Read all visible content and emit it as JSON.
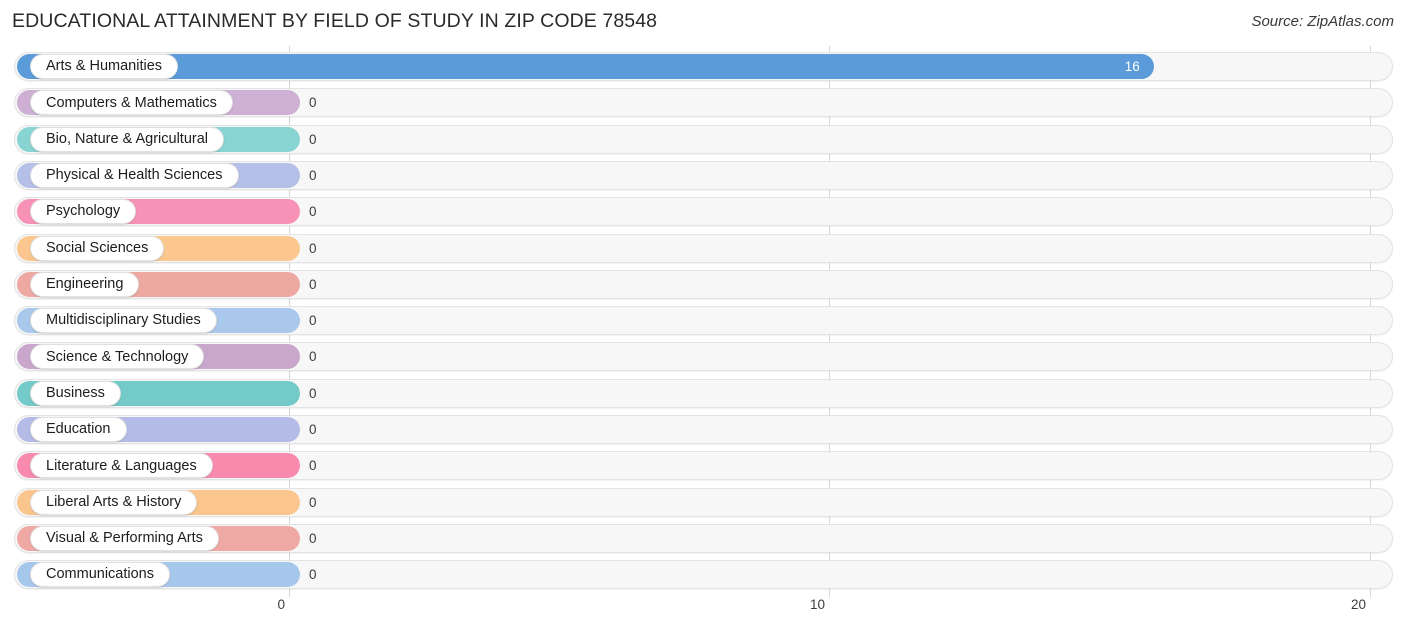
{
  "header": {
    "title": "EDUCATIONAL ATTAINMENT BY FIELD OF STUDY IN ZIP CODE 78548",
    "source": "Source: ZipAtlas.com"
  },
  "chart_data": {
    "type": "bar",
    "orientation": "horizontal",
    "title": "EDUCATIONAL ATTAINMENT BY FIELD OF STUDY IN ZIP CODE 78548",
    "xlabel": "",
    "ylabel": "",
    "xlim": [
      0,
      20
    ],
    "xticks": [
      0,
      10,
      20
    ],
    "xtick_labels": [
      "0",
      "10",
      "20"
    ],
    "grid": true,
    "legend": false,
    "categories": [
      "Arts & Humanities",
      "Computers & Mathematics",
      "Bio, Nature & Agricultural",
      "Physical & Health Sciences",
      "Psychology",
      "Social Sciences",
      "Engineering",
      "Multidisciplinary Studies",
      "Science & Technology",
      "Business",
      "Education",
      "Literature & Languages",
      "Liberal Arts & History",
      "Visual & Performing Arts",
      "Communications"
    ],
    "values": [
      16,
      0,
      0,
      0,
      0,
      0,
      0,
      0,
      0,
      0,
      0,
      0,
      0,
      0,
      0
    ],
    "value_labels": [
      "16",
      "0",
      "0",
      "0",
      "0",
      "0",
      "0",
      "0",
      "0",
      "0",
      "0",
      "0",
      "0",
      "0",
      "0"
    ],
    "colors": [
      "#5b9bd9",
      "#cdb0d4",
      "#87d4d2",
      "#b4c0e8",
      "#f891b6",
      "#fbc78e",
      "#eda8a2",
      "#a9c8ec",
      "#c9a7cd",
      "#74c9c9",
      "#b4bbe6",
      "#f78aad",
      "#fbc68d",
      "#efa9a4",
      "#a6c7ec"
    ]
  },
  "rows": [
    {
      "label": "Arts & Humanities",
      "value": "16",
      "color": "#5b9bd9",
      "inside": true
    },
    {
      "label": "Computers & Mathematics",
      "value": "0",
      "color": "#cdb0d4",
      "inside": false
    },
    {
      "label": "Bio, Nature & Agricultural",
      "value": "0",
      "color": "#87d4d2",
      "inside": false
    },
    {
      "label": "Physical & Health Sciences",
      "value": "0",
      "color": "#b4c0e8",
      "inside": false
    },
    {
      "label": "Psychology",
      "value": "0",
      "color": "#f891b6",
      "inside": false
    },
    {
      "label": "Social Sciences",
      "value": "0",
      "color": "#fbc78e",
      "inside": false
    },
    {
      "label": "Engineering",
      "value": "0",
      "color": "#eda8a2",
      "inside": false
    },
    {
      "label": "Multidisciplinary Studies",
      "value": "0",
      "color": "#a9c8ec",
      "inside": false
    },
    {
      "label": "Science & Technology",
      "value": "0",
      "color": "#c9a7cd",
      "inside": false
    },
    {
      "label": "Business",
      "value": "0",
      "color": "#74c9c9",
      "inside": false
    },
    {
      "label": "Education",
      "value": "0",
      "color": "#b4bbe6",
      "inside": false
    },
    {
      "label": "Literature & Languages",
      "value": "0",
      "color": "#f78aad",
      "inside": false
    },
    {
      "label": "Liberal Arts & History",
      "value": "0",
      "color": "#fbc68d",
      "inside": false
    },
    {
      "label": "Visual & Performing Arts",
      "value": "0",
      "color": "#efa9a4",
      "inside": false
    },
    {
      "label": "Communications",
      "value": "0",
      "color": "#a6c7ec",
      "inside": false
    }
  ],
  "axis": {
    "ticks": [
      "0",
      "10",
      "20"
    ]
  }
}
